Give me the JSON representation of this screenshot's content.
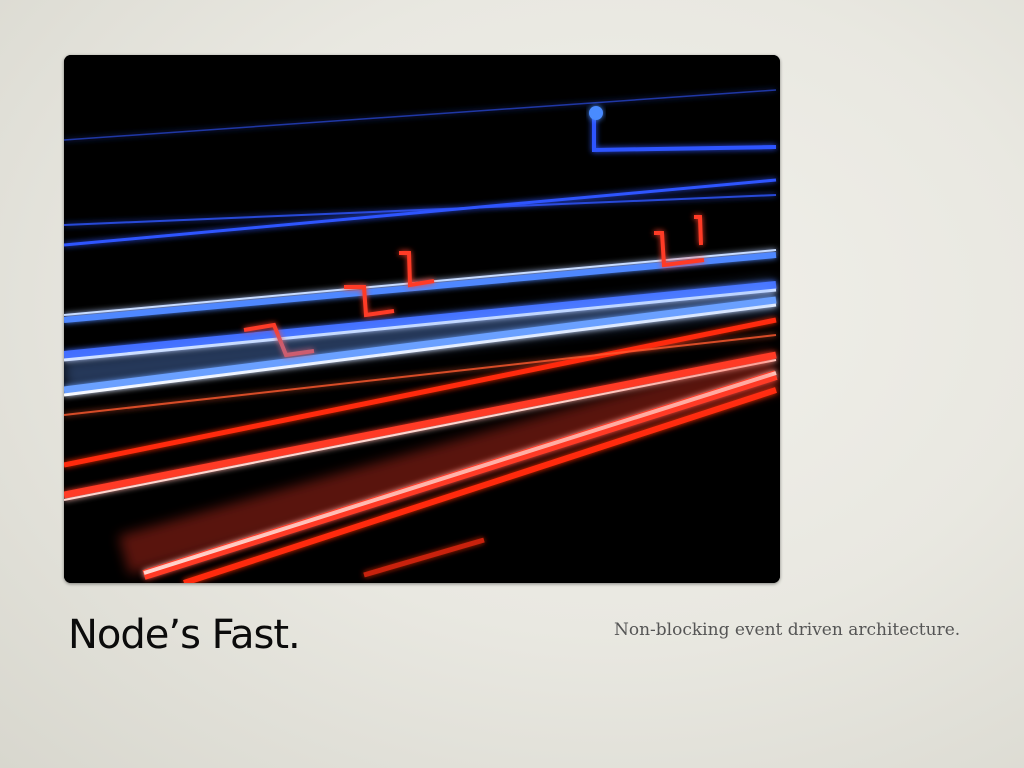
{
  "slide": {
    "title": "Node’s Fast.",
    "subtitle": "Non-blocking event driven architecture."
  },
  "photo": {
    "icon": "long-exposure-traffic-light-trails-image"
  },
  "colors": {
    "background": "#e9e8e1",
    "title": "#0b0b0b",
    "subtitle": "#555555",
    "photo_base": "#000000",
    "trail_red": "#ff3a20",
    "trail_blue": "#3a6bff"
  }
}
